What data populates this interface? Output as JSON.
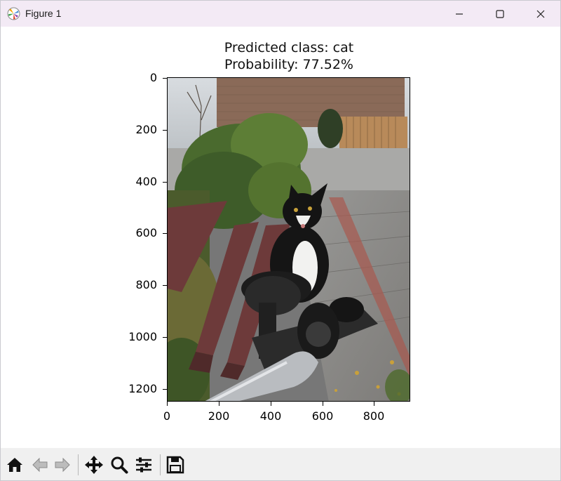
{
  "window": {
    "title": "Figure 1",
    "controls": [
      "minimize",
      "maximize",
      "close"
    ]
  },
  "figure": {
    "title_line1": "Predicted class: cat",
    "title_line2": "Probability: 77.52%",
    "image_subject": "black-and-white cat sitting on a bicycle seat next to a wooden bench",
    "y_ticks": [
      "0",
      "200",
      "400",
      "600",
      "800",
      "1000",
      "1200"
    ],
    "x_ticks": [
      "0",
      "200",
      "400",
      "600",
      "800"
    ]
  },
  "chart_data": {
    "type": "image",
    "title": "Predicted class: cat\nProbability: 77.52%",
    "xlim": [
      0,
      940
    ],
    "ylim": [
      1250,
      0
    ],
    "xticks": [
      0,
      200,
      400,
      600,
      800
    ],
    "yticks": [
      0,
      200,
      400,
      600,
      800,
      1000,
      1200
    ],
    "xlabel": "",
    "ylabel": "",
    "grid": false
  },
  "toolbar": {
    "tools": [
      {
        "name": "home-icon",
        "label": "Home"
      },
      {
        "name": "back-icon",
        "label": "Back"
      },
      {
        "name": "forward-icon",
        "label": "Forward"
      },
      {
        "name": "pan-icon",
        "label": "Pan"
      },
      {
        "name": "zoom-icon",
        "label": "Zoom"
      },
      {
        "name": "configure-subplots-icon",
        "label": "Subplots"
      },
      {
        "name": "save-icon",
        "label": "Save"
      }
    ]
  },
  "colors": {
    "titlebar_bg": "#f3eaf5",
    "toolbar_bg": "#f0f0f0",
    "text": "#000000"
  }
}
